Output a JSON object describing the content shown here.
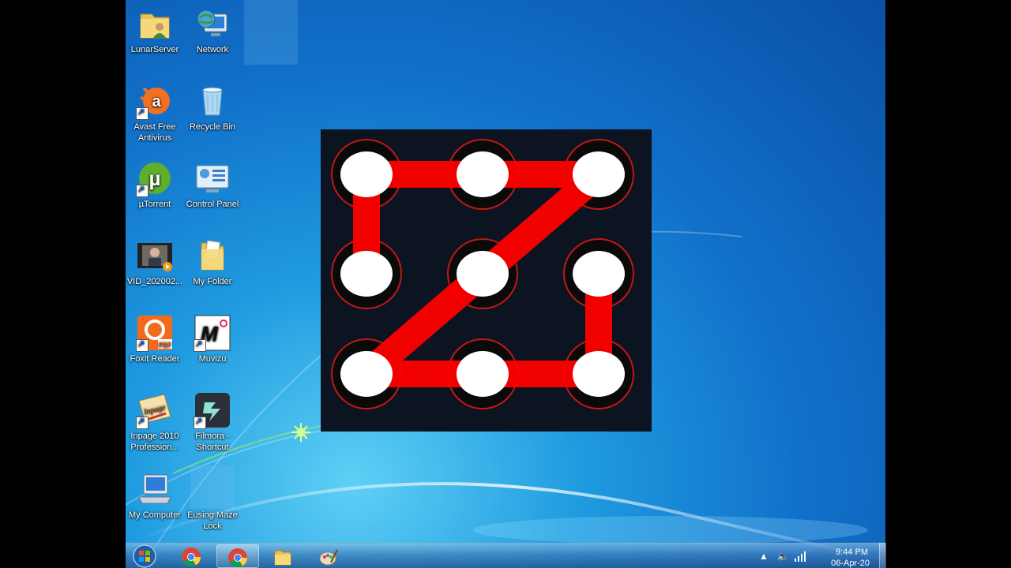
{
  "desktop": {
    "icons": [
      {
        "label": "LunarServer",
        "icon": "user-folder-icon"
      },
      {
        "label": "Network",
        "icon": "network-globe-icon"
      },
      {
        "label": "Avast Free Antivirus",
        "icon": "avast-icon"
      },
      {
        "label": "Recycle Bin",
        "icon": "recycle-bin-icon"
      },
      {
        "label": "µTorrent",
        "icon": "utorrent-icon"
      },
      {
        "label": "Control Panel",
        "icon": "control-panel-icon"
      },
      {
        "label": "VID_202002...",
        "icon": "video-file-icon"
      },
      {
        "label": "My Folder",
        "icon": "folder-icon"
      },
      {
        "label": "Foxit Reader",
        "icon": "foxit-pdf-icon"
      },
      {
        "label": "Muvizu",
        "icon": "muvizu-icon"
      },
      {
        "label": "Inpage 2010 Profession...",
        "icon": "inpage-icon"
      },
      {
        "label": "Filmora - Shortcut",
        "icon": "filmora-icon"
      },
      {
        "label": "My Computer",
        "icon": "computer-icon"
      },
      {
        "label": "Eusing Maze Lock",
        "icon": "maze-lock-icon"
      }
    ]
  },
  "pattern_lock": {
    "grid": "3x3",
    "pattern_sequence": [
      1,
      2,
      3,
      5,
      7,
      8,
      9,
      6
    ],
    "pattern_color": "#ff0000",
    "node_color": "#ffffff",
    "background_color": "#0b1420"
  },
  "taskbar": {
    "start_button": "windows-start-orb-icon",
    "pinned": [
      {
        "name": "chrome-icon",
        "active": false
      },
      {
        "name": "chrome-icon",
        "active": true
      },
      {
        "name": "file-explorer-icon",
        "active": false
      },
      {
        "name": "paint-icon",
        "active": false
      }
    ],
    "tray": {
      "icons": [
        "show-hidden-icons-arrow",
        "speaker-icon",
        "network-signal-icon"
      ],
      "time": "9:44 PM",
      "date": "06-Apr-20"
    }
  }
}
